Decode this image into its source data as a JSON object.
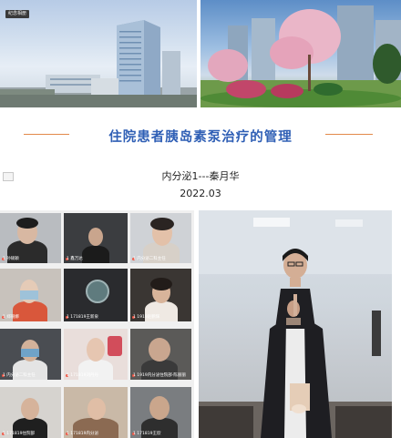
{
  "header": {
    "badge_text": "纪念相册",
    "title": "住院患者胰岛素泵治疗的管理",
    "author": "内分泌1---秦月华",
    "date": "2022.03"
  },
  "meeting": {
    "participants": [
      {
        "label": "1 孙硕颖"
      },
      {
        "label": "1 鑫万达"
      },
      {
        "label": "1 内分泌二科主任"
      },
      {
        "label": "1 郑丽娜"
      },
      {
        "label": "1 171819王新泉"
      },
      {
        "label": "1 1919赵鹏辉"
      },
      {
        "label": "1 内分泌二科主任"
      },
      {
        "label": "1 171819刘丹丹"
      },
      {
        "label": "1 1919内分泌住院部-陈丽丽"
      },
      {
        "label": "1 171819住院部"
      },
      {
        "label": "1 171819内分泌"
      },
      {
        "label": "1 171819王欣"
      }
    ]
  },
  "colors": {
    "title": "#2f5fb5",
    "title_rule": "#e3894a",
    "tile_bg": "#2b2c2f"
  },
  "icons": {
    "document": "document-icon",
    "mic": "mic-off-icon"
  }
}
